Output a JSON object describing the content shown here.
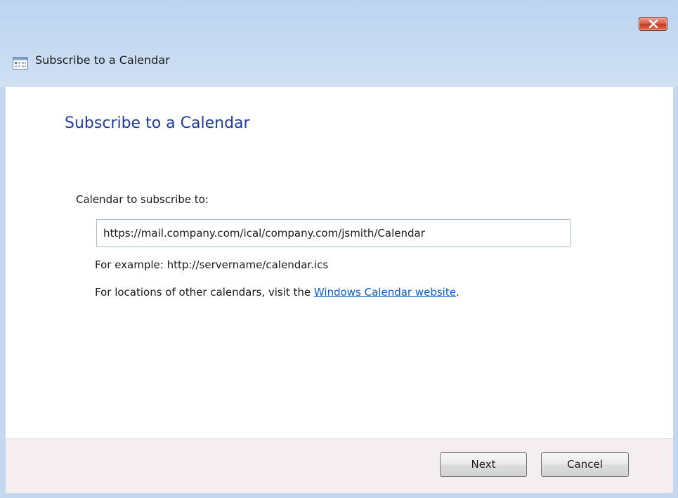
{
  "window": {
    "title": "Subscribe to a Calendar"
  },
  "content": {
    "heading": "Subscribe to a Calendar",
    "field_label": "Calendar to subscribe to:",
    "url_value": "https://mail.company.com/ical/company.com/jsmith/Calendar",
    "example_text": "For example: http://servername/calendar.ics",
    "locations_prefix": "For locations of other calendars, visit the ",
    "locations_link": "Windows Calendar website",
    "locations_suffix": "."
  },
  "footer": {
    "next_label": "Next",
    "cancel_label": "Cancel"
  },
  "icons": {
    "close": "close-icon",
    "app": "calendar-icon"
  },
  "colors": {
    "heading": "#1f3c9c",
    "link": "#0a5fcc",
    "close_button": "#c53a1f",
    "titlebar": "#c3d7ef"
  }
}
